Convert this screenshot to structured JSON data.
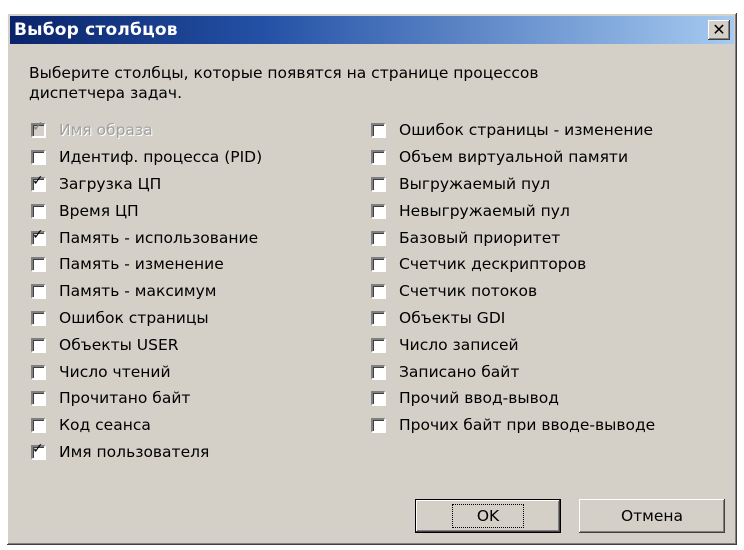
{
  "window": {
    "title": "Выбор столбцов",
    "close_glyph": "✕"
  },
  "description": {
    "line1": "Выберите столбцы, которые появятся на странице процессов",
    "line2": "диспетчера задач."
  },
  "left_options": [
    {
      "label": "Имя образа",
      "checked": true,
      "disabled": true
    },
    {
      "label": "Идентиф. процесса (PID)",
      "checked": false,
      "disabled": false
    },
    {
      "label": "Загрузка ЦП",
      "checked": true,
      "disabled": false
    },
    {
      "label": "Время ЦП",
      "checked": false,
      "disabled": false
    },
    {
      "label": "Память - использование",
      "checked": true,
      "disabled": false
    },
    {
      "label": "Память - изменение",
      "checked": false,
      "disabled": false
    },
    {
      "label": "Память - максимум",
      "checked": false,
      "disabled": false
    },
    {
      "label": "Ошибок страницы",
      "checked": false,
      "disabled": false
    },
    {
      "label": "Объекты USER",
      "checked": false,
      "disabled": false
    },
    {
      "label": "Число чтений",
      "checked": false,
      "disabled": false
    },
    {
      "label": "Прочитано байт",
      "checked": false,
      "disabled": false
    },
    {
      "label": "Код сеанса",
      "checked": false,
      "disabled": false
    },
    {
      "label": "Имя пользователя",
      "checked": true,
      "disabled": false
    }
  ],
  "right_options": [
    {
      "label": "Ошибок страницы - изменение",
      "checked": false,
      "disabled": false
    },
    {
      "label": "Объем виртуальной памяти",
      "checked": false,
      "disabled": false
    },
    {
      "label": "Выгружаемый пул",
      "checked": false,
      "disabled": false
    },
    {
      "label": "Невыгружаемый пул",
      "checked": false,
      "disabled": false
    },
    {
      "label": "Базовый приоритет",
      "checked": false,
      "disabled": false
    },
    {
      "label": "Счетчик дескрипторов",
      "checked": false,
      "disabled": false
    },
    {
      "label": "Счетчик потоков",
      "checked": false,
      "disabled": false
    },
    {
      "label": "Объекты GDI",
      "checked": false,
      "disabled": false
    },
    {
      "label": "Число записей",
      "checked": false,
      "disabled": false
    },
    {
      "label": "Записано байт",
      "checked": false,
      "disabled": false
    },
    {
      "label": "Прочий ввод-вывод",
      "checked": false,
      "disabled": false
    },
    {
      "label": "Прочих байт при вводе-выводе",
      "checked": false,
      "disabled": false
    }
  ],
  "buttons": {
    "ok_label": "OK",
    "cancel_label": "Отмена"
  },
  "check_glyph": "✓",
  "colors": {
    "title_gradient_start": "#0a246a",
    "title_gradient_end": "#a6caf0",
    "face": "#d4d0c8"
  }
}
